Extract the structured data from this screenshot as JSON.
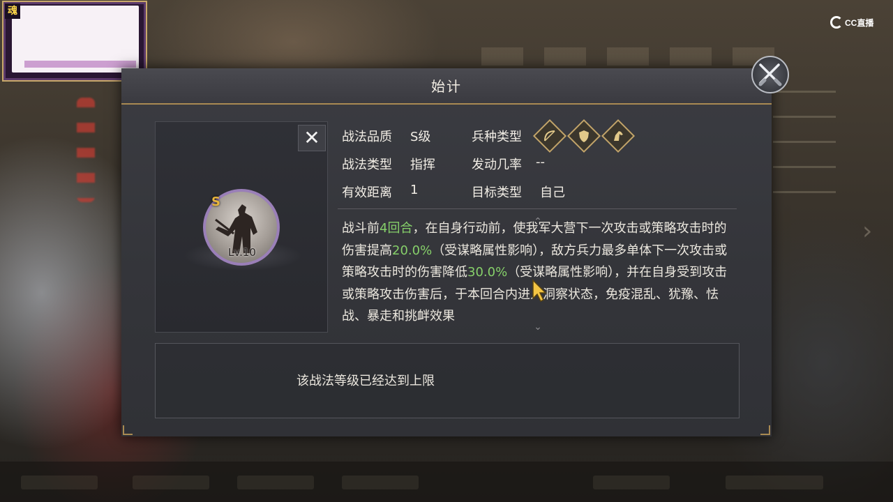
{
  "dialog": {
    "title": "始计",
    "close_icon": "crossed-swords-icon"
  },
  "skill": {
    "grade_badge": "S",
    "level": "Lv.10",
    "unequip_label": "✕"
  },
  "attributes": {
    "quality_label": "战法品质",
    "quality_value": "S级",
    "type_label": "战法类型",
    "type_value": "指挥",
    "range_label": "有效距离",
    "range_value": "1",
    "troop_label": "兵种类型",
    "troop_icons": [
      "bow-icon",
      "shield-icon",
      "cavalry-icon"
    ],
    "trigger_label": "发动几率",
    "trigger_value": "--",
    "target_label": "目标类型",
    "target_value": "自己"
  },
  "description": {
    "parts": [
      {
        "text": "战斗前",
        "highlight": false
      },
      {
        "text": "4回合",
        "highlight": true
      },
      {
        "text": "，在自身行动前，使我军大营下一次攻击或策略攻击时的伤害提高",
        "highlight": false
      },
      {
        "text": "20.0%",
        "highlight": true
      },
      {
        "text": "（受谋略属性影响），敌方兵力最多单体下一次攻击或策略攻击时的伤害降低",
        "highlight": false
      },
      {
        "text": "30.0%",
        "highlight": true
      },
      {
        "text": "（受谋略属性影响），并在自身受到攻击或策略攻击伤害后，于本回合内进入洞察状态，免疫混乱、犹豫、怯战、暴走和挑衅效果",
        "highlight": false
      }
    ]
  },
  "status": {
    "message": "该战法等级已经达到上限"
  },
  "overlay": {
    "avatar_tag": "魂",
    "broadcaster": "CC直播"
  },
  "colors": {
    "highlight": "#86d06a",
    "gold": "#a98a52",
    "grade": "#e7b43c"
  }
}
